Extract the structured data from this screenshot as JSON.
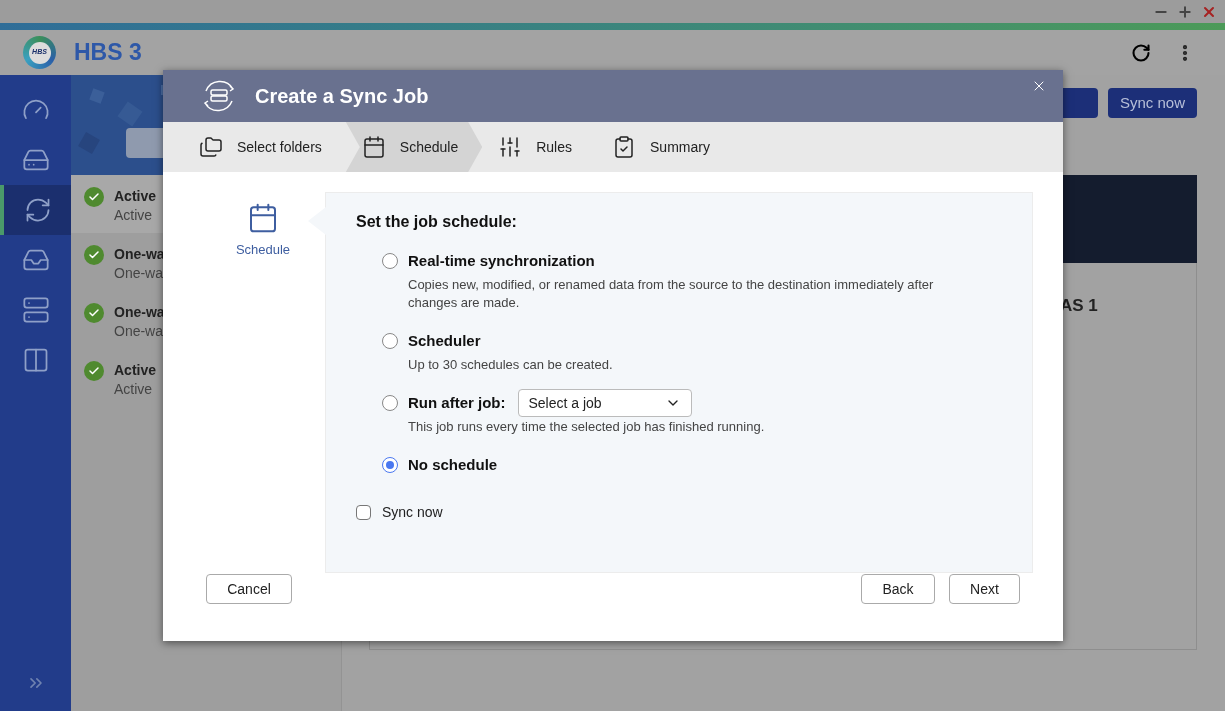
{
  "app": {
    "logo_text": "HBS",
    "title": "HBS 3"
  },
  "nav_items": [
    {
      "selected": false
    },
    {
      "selected": false
    },
    {
      "selected": true
    },
    {
      "selected": false
    },
    {
      "selected": false
    },
    {
      "selected": false
    }
  ],
  "jobs": [
    {
      "name": "Active",
      "detail": "Active"
    },
    {
      "name": "One-wa",
      "detail": "One-wa"
    },
    {
      "name": "One-wa",
      "detail": "One-wa"
    },
    {
      "name": "Active",
      "detail": "Active"
    }
  ],
  "header_button": "Sync now",
  "main": {
    "heading": "AS 1"
  },
  "dialog": {
    "title": "Create a Sync Job",
    "steps": [
      {
        "label": "Select folders",
        "selected": false
      },
      {
        "label": "Schedule",
        "selected": true
      },
      {
        "label": "Rules",
        "selected": false
      },
      {
        "label": "Summary",
        "selected": false
      }
    ],
    "side_label": "Schedule",
    "heading": "Set the job schedule:",
    "options": [
      {
        "label": "Real-time synchronization",
        "description": "Copies new, modified, or renamed data from the source to the destination immediately after changes are made.",
        "selected": false
      },
      {
        "label": "Scheduler",
        "description": "Up to 30 schedules can be created.",
        "selected": false
      },
      {
        "label": "Run after job:",
        "select": "Select a job",
        "description": "This job runs every time the selected job has finished running.",
        "selected": false
      },
      {
        "label": "No schedule",
        "selected": true
      }
    ],
    "sync_now": {
      "label": "Sync now",
      "checked": false
    },
    "buttons": {
      "cancel": "Cancel",
      "back": "Back",
      "next": "Next"
    }
  }
}
